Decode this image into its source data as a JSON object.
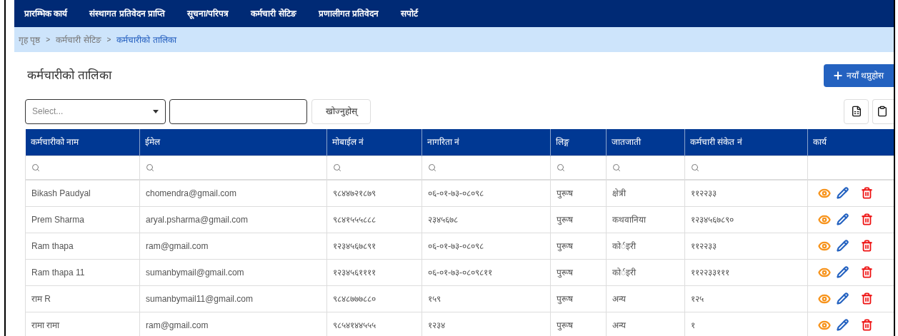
{
  "nav": [
    {
      "label": "प्रारम्भिक कार्य"
    },
    {
      "label": "संस्थागत प्रतिवेदन प्राप्ति"
    },
    {
      "label": "सूचना/परिपत्र"
    },
    {
      "label": "कर्मचारी सेटिङ"
    },
    {
      "label": "प्रणालीगत प्रतिवेदन"
    },
    {
      "label": "सपोर्ट"
    }
  ],
  "breadcrumb": [
    {
      "label": "गृह पृष्ठ",
      "selected": false
    },
    {
      "label": "कर्मचारी सेटिङ",
      "selected": false
    },
    {
      "label": "कर्मचारीको तालिका",
      "selected": true
    }
  ],
  "breadcrumb_separator": ">",
  "title": "कर्मचारीको तालिका",
  "add_button": "नयाँ थप्नुहोस",
  "filter": {
    "select_placeholder": "Select...",
    "search_button": "खोज्नुहोस्"
  },
  "table": {
    "columns": [
      "कर्मचारीको नाम",
      "ईमेल",
      "मोबाईल नं",
      "नागरिता नं",
      "लिङ्ग",
      "जातजाती",
      "कर्मचारी संकेत नं",
      "कार्य"
    ],
    "rows": [
      {
        "cells": [
          "Bikash Paudyal",
          "chomendra@gmail.com",
          "९८४४७२१८७९",
          "०६-०१-७३-०८०९८",
          "पुरूष",
          "क्षेत्री",
          "११२२३३"
        ]
      },
      {
        "cells": [
          "Prem Sharma",
          "aryal.psharma@gmail.com",
          "९८४१५५५८८८",
          "२३४५६७८",
          "पुरूष",
          "कथवानिया",
          "१२३४५६७८९०"
        ]
      },
      {
        "cells": [
          "Ram thapa",
          "ram@gmail.com",
          "१२३४५६७८९१",
          "०६-०१-७३-०८०९८",
          "पुरूष",
          "कोर्इरी",
          "११२२३३"
        ]
      },
      {
        "cells": [
          "Ram thapa 11",
          "sumanbymail@gmail.com",
          "१२३४५६११११",
          "०६-०१-७३-०८०९८११",
          "पुरूष",
          "कोर्इरी",
          "११२२३३१११"
        ]
      },
      {
        "cells": [
          "राम R",
          "sumanbymail11@gmail.com",
          "९८४८७७७८८०",
          "१५९",
          "पुरूष",
          "अन्य",
          "१२५"
        ]
      },
      {
        "cells": [
          "रामा रामा",
          "ram@gmail.com",
          "९८५४१४४५५५",
          "१२३४",
          "पुरूष",
          "अन्य",
          "१"
        ]
      }
    ]
  }
}
